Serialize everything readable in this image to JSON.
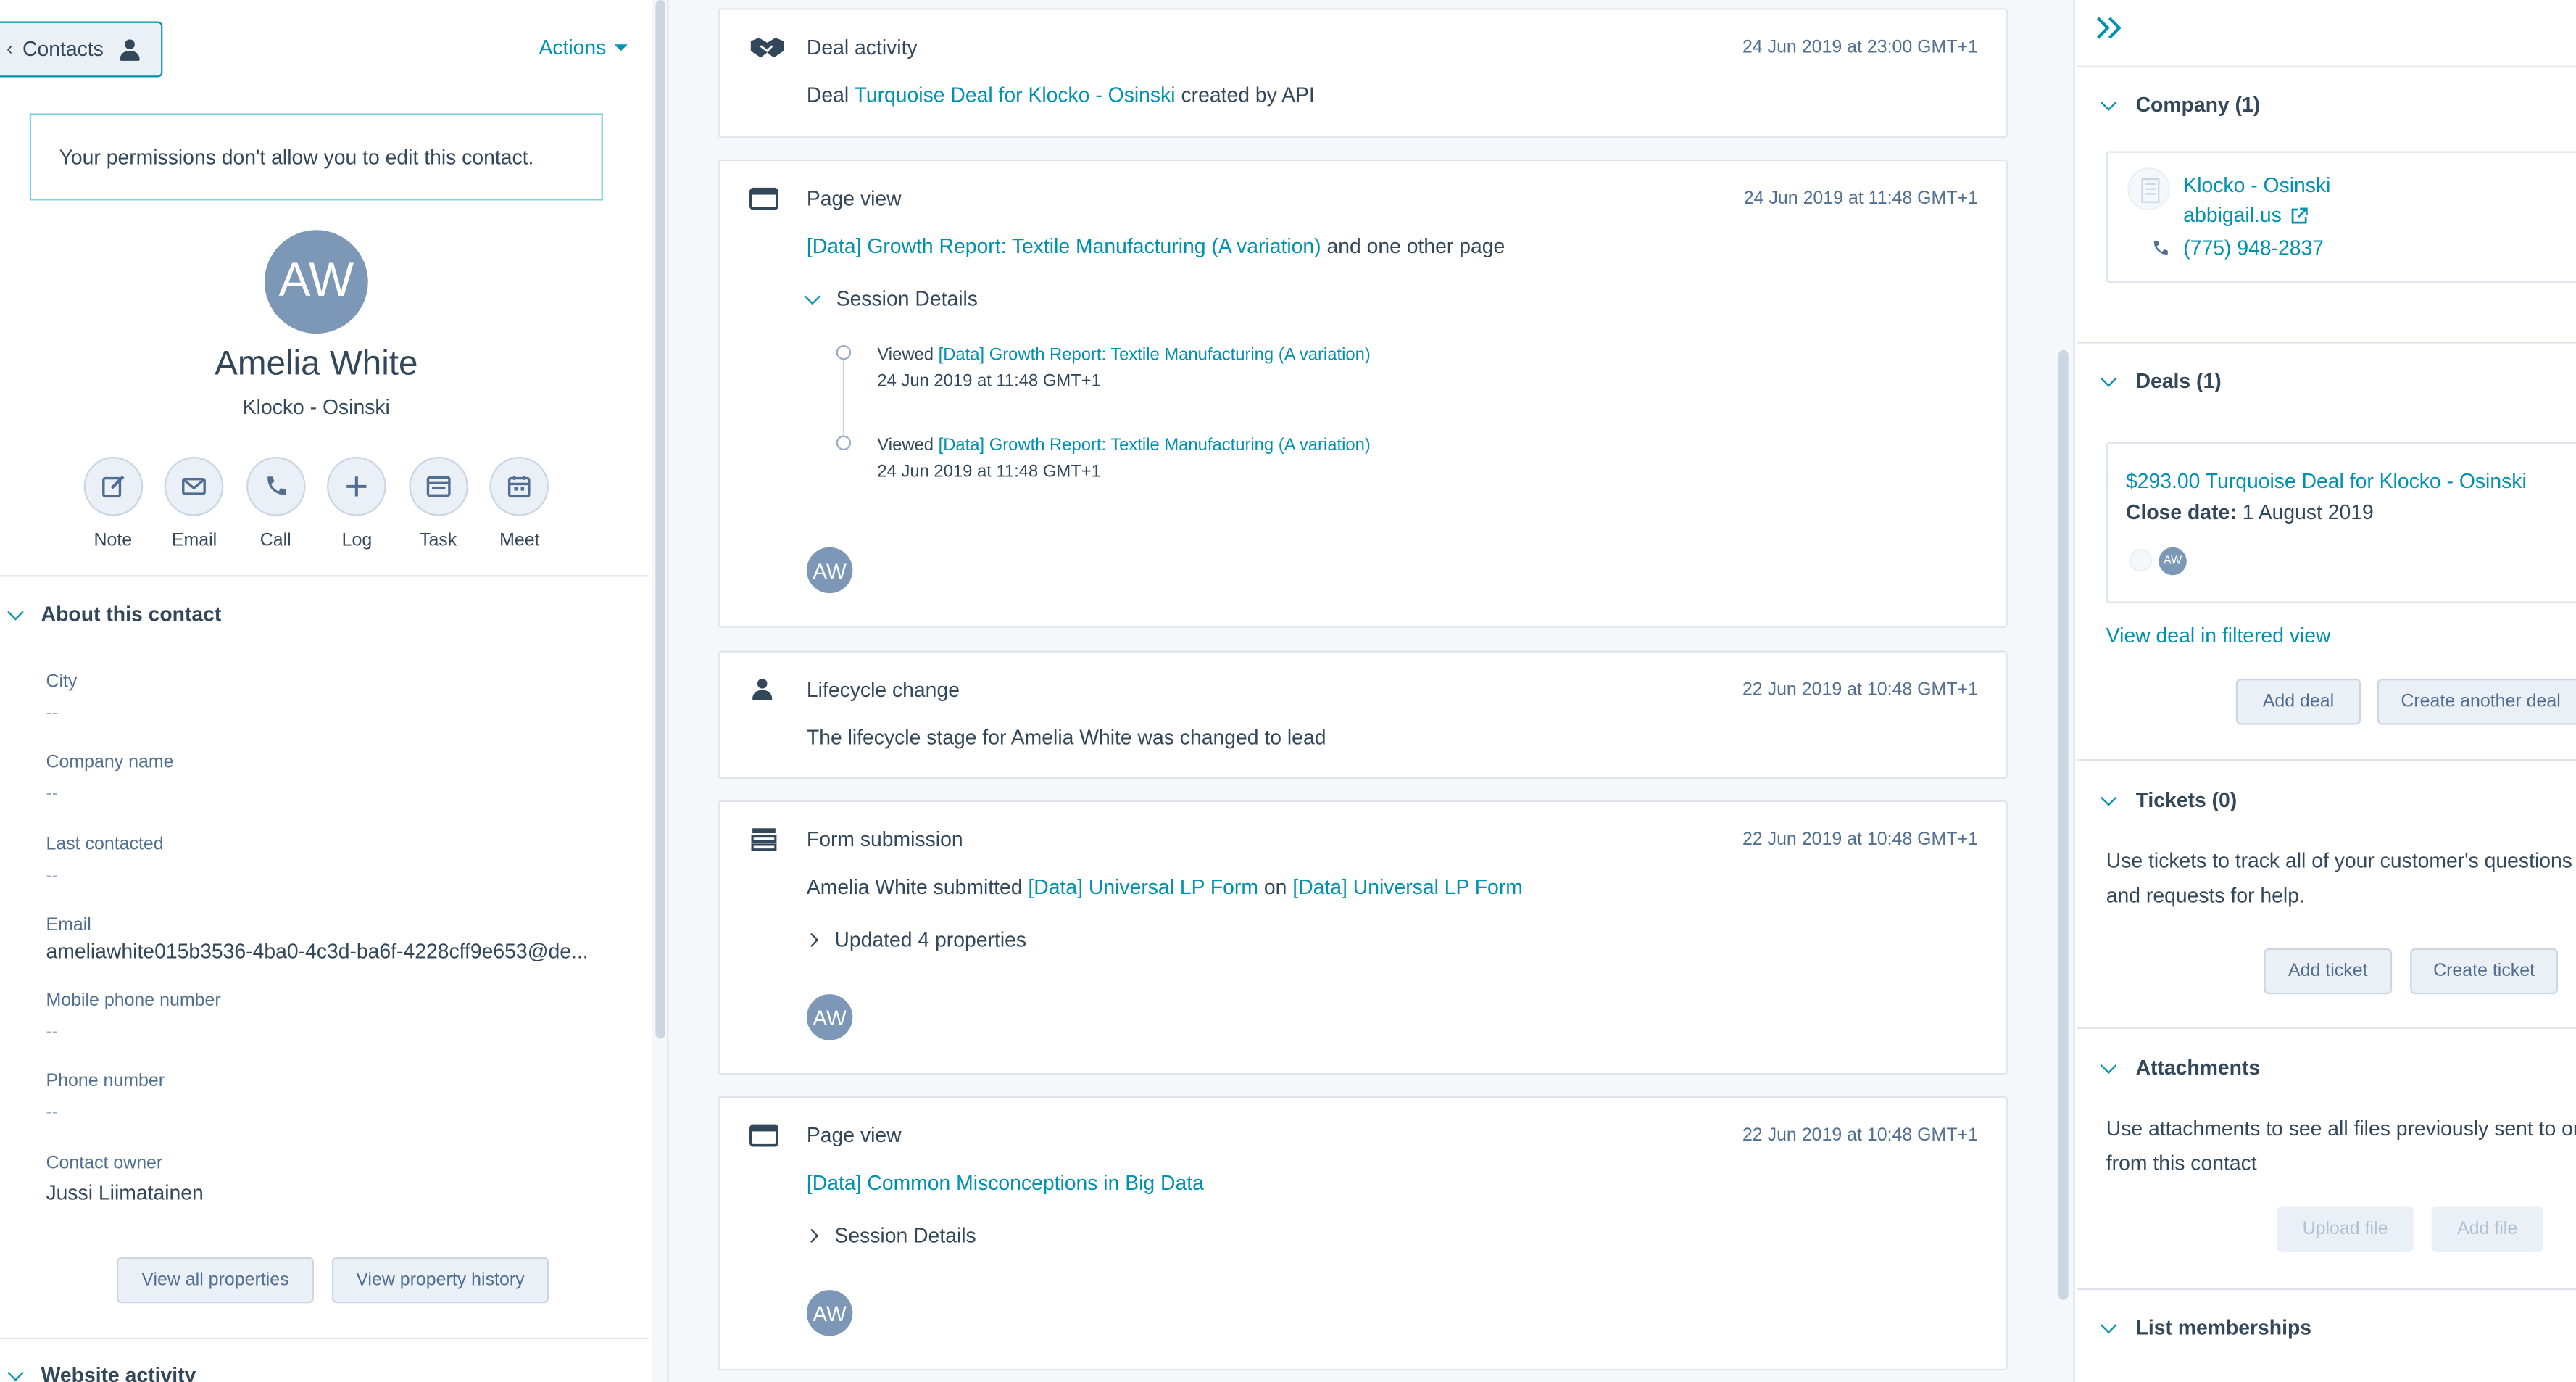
{
  "left": {
    "contacts_label": "Contacts",
    "actions_label": "Actions",
    "permission_notice": "Your permissions don't allow you to edit this contact.",
    "avatar_initials": "AW",
    "name": "Amelia White",
    "company": "Klocko - Osinski",
    "actions": [
      {
        "label": "Note",
        "icon": "note-icon"
      },
      {
        "label": "Email",
        "icon": "email-icon"
      },
      {
        "label": "Call",
        "icon": "call-icon"
      },
      {
        "label": "Log",
        "icon": "plus-icon"
      },
      {
        "label": "Task",
        "icon": "task-icon"
      },
      {
        "label": "Meet",
        "icon": "calendar-icon"
      }
    ],
    "about_heading": "About this contact",
    "properties": [
      {
        "label": "City",
        "value": "--"
      },
      {
        "label": "Company name",
        "value": "--"
      },
      {
        "label": "Last contacted",
        "value": "--"
      },
      {
        "label": "Email",
        "value": "ameliawhite015b3536-4ba0-4c3d-ba6f-4228cff9e653@de..."
      },
      {
        "label": "Mobile phone number",
        "value": "--"
      },
      {
        "label": "Phone number",
        "value": "--"
      },
      {
        "label": "Contact owner",
        "value": "Jussi Liimatainen"
      }
    ],
    "view_all_properties": "View all properties",
    "view_property_history": "View property history",
    "website_activity_heading": "Website activity"
  },
  "timeline": {
    "deal_activity": {
      "title": "Deal activity",
      "date": "24 Jun 2019 at 23:00 GMT+1",
      "prefix": "Deal",
      "link": "Turquoise Deal for Klocko - Osinski",
      "suffix": "created by API"
    },
    "page_view_1": {
      "title": "Page view",
      "date": "24 Jun 2019 at 11:48 GMT+1",
      "link": "[Data] Growth Report: Textile Manufacturing (A variation)",
      "suffix": "and one other page",
      "session_label": "Session Details",
      "sessions": [
        {
          "prefix": "Viewed",
          "link": "[Data] Growth Report: Textile Manufacturing (A variation)",
          "time": "24 Jun 2019 at 11:48 GMT+1"
        },
        {
          "prefix": "Viewed",
          "link": "[Data] Growth Report: Textile Manufacturing (A variation)",
          "time": "24 Jun 2019 at 11:48 GMT+1"
        }
      ],
      "avatar": "AW"
    },
    "lifecycle": {
      "title": "Lifecycle change",
      "date": "22 Jun 2019 at 10:48 GMT+1",
      "text": "The lifecycle stage for Amelia White was changed to lead"
    },
    "form": {
      "title": "Form submission",
      "date": "22 Jun 2019 at 10:48 GMT+1",
      "prefix": "Amelia White submitted",
      "link1": "[Data] Universal LP Form",
      "middle": "on",
      "link2": "[Data] Universal LP Form",
      "updated": "Updated 4 properties",
      "avatar": "AW"
    },
    "page_view_2": {
      "title": "Page view",
      "date": "22 Jun 2019 at 10:48 GMT+1",
      "link": "[Data] Common Misconceptions in Big Data",
      "session_label": "Session Details",
      "avatar": "AW"
    }
  },
  "right": {
    "company_heading": "Company (1)",
    "company_name": "Klocko - Osinski",
    "company_domain": "abbigail.us",
    "company_phone": "(775) 948-2837",
    "deals_heading": "Deals (1)",
    "deal_title": "$293.00 Turquoise Deal for Klocko - Osinski",
    "deal_close_label": "Close date:",
    "deal_close_value": "1 August 2019",
    "deal_avatar": "AW",
    "view_deal_link": "View deal in filtered view",
    "add_deal": "Add deal",
    "create_another_deal": "Create another deal",
    "tickets_heading": "Tickets (0)",
    "tickets_text": "Use tickets to track all of your customer's questions and requests for help.",
    "add_ticket": "Add ticket",
    "create_ticket": "Create ticket",
    "attachments_heading": "Attachments",
    "attachments_text": "Use attachments to see all files previously sent to or from this contact",
    "upload_file": "Upload file",
    "add_file": "Add file",
    "list_memberships_heading": "List memberships"
  },
  "colors": {
    "link": "#0091ae",
    "text": "#33475b",
    "avatar": "#7c98b6",
    "background": "#f5f8fa"
  }
}
